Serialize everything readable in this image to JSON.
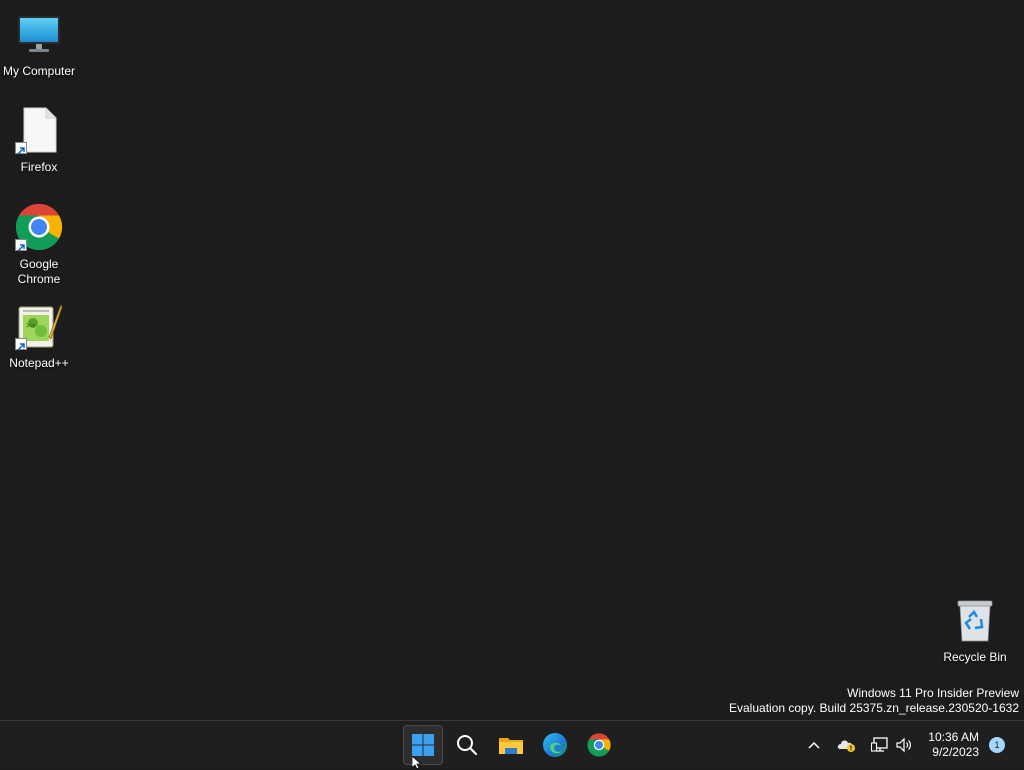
{
  "desktop": {
    "icons": [
      {
        "label": "My Computer"
      },
      {
        "label": "Firefox"
      },
      {
        "label": "Google Chrome"
      },
      {
        "label": "Notepad++"
      },
      {
        "label": "Recycle Bin"
      }
    ]
  },
  "watermark": {
    "line1": "Windows 11 Pro Insider Preview",
    "line2": "Evaluation copy. Build 25375.zn_release.230520-1632"
  },
  "taskbar": {
    "apps": [
      {
        "name": "start-icon",
        "active": true
      },
      {
        "name": "search-icon"
      },
      {
        "name": "file-explorer-icon"
      },
      {
        "name": "edge-icon"
      },
      {
        "name": "chrome-icon"
      }
    ],
    "tray": {
      "icons": [
        "chevron-up-icon",
        "onedrive-warning-icon",
        "network-icon",
        "volume-icon"
      ],
      "time": "10:36 AM",
      "date": "9/2/2023",
      "notification_count": "1"
    }
  },
  "colors": {
    "desktop_bg": "#1c1c1c",
    "taskbar_bg": "#1f1f1f",
    "accent_blue": "#0078d4"
  }
}
